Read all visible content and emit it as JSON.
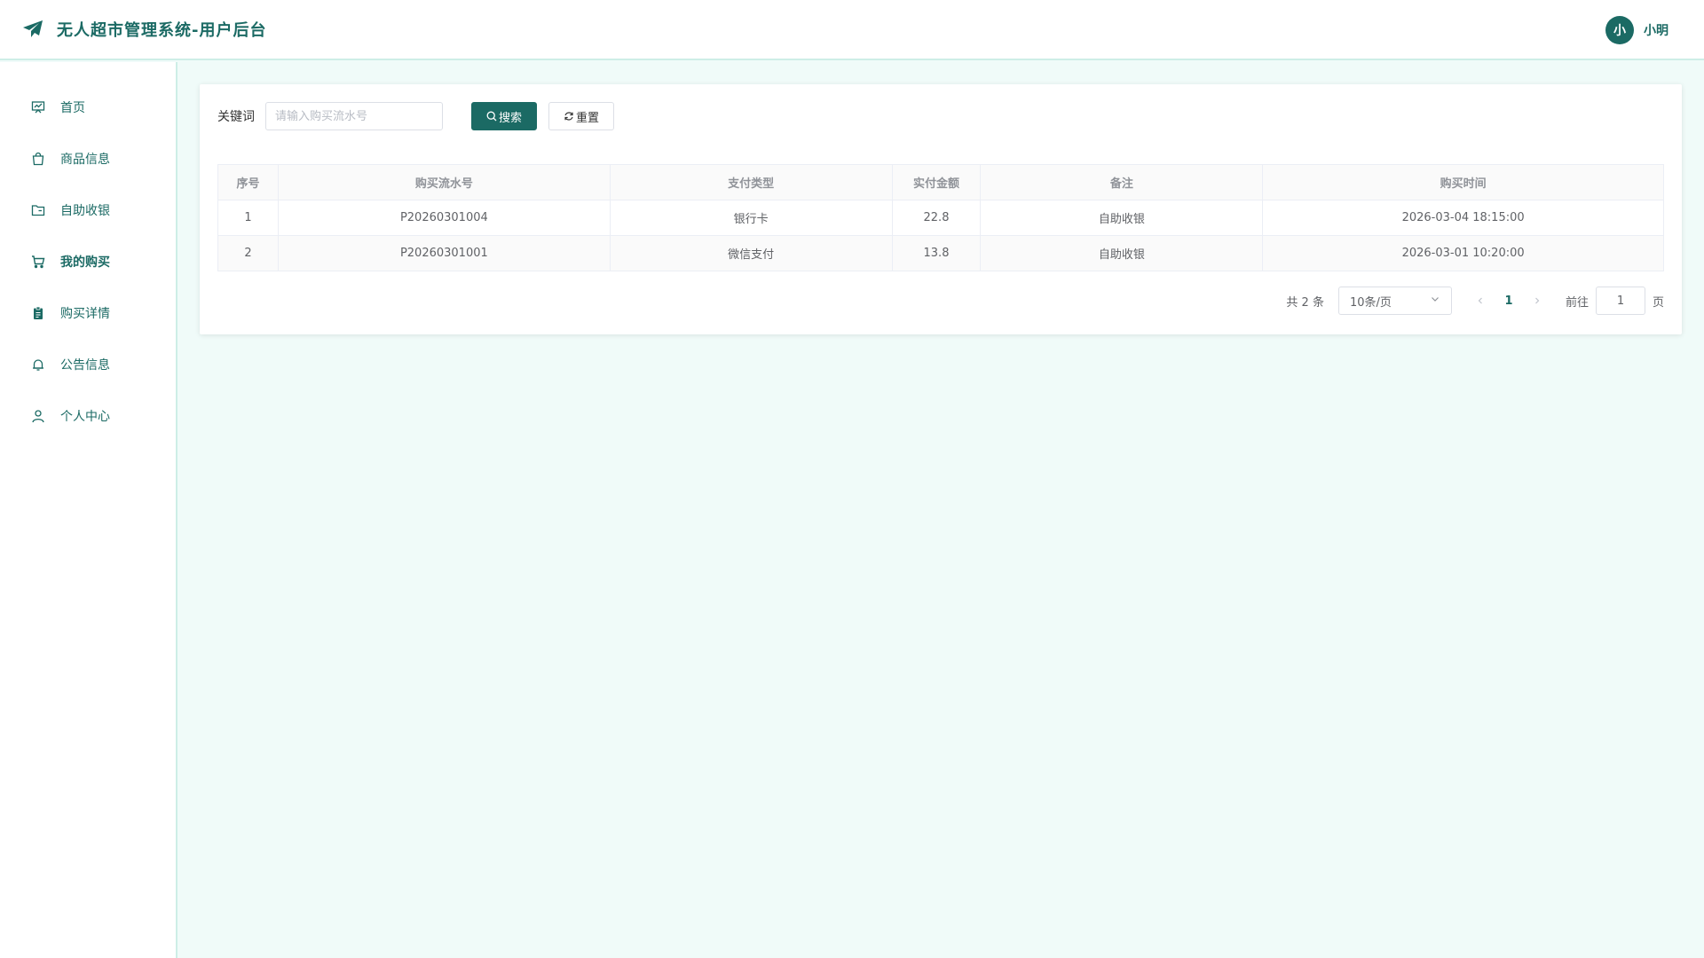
{
  "header": {
    "title": "无人超市管理系统-用户后台",
    "avatar_text": "小",
    "username": "小明"
  },
  "sidebar": {
    "items": [
      {
        "label": "首页",
        "icon": "chart-board-icon"
      },
      {
        "label": "商品信息",
        "icon": "shopping-bag-icon"
      },
      {
        "label": "自助收银",
        "icon": "folder-icon"
      },
      {
        "label": "我的购买",
        "icon": "shopping-cart-icon",
        "active": true
      },
      {
        "label": "购买详情",
        "icon": "clipboard-icon"
      },
      {
        "label": "公告信息",
        "icon": "bell-icon"
      },
      {
        "label": "个人中心",
        "icon": "user-icon"
      }
    ]
  },
  "search": {
    "label": "关键词",
    "placeholder": "请输入购买流水号",
    "value": "",
    "search_label": "搜索",
    "reset_label": "重置"
  },
  "table": {
    "columns": [
      "序号",
      "购买流水号",
      "支付类型",
      "实付金额",
      "备注",
      "购买时间"
    ],
    "rows": [
      [
        "1",
        "P20260301004",
        "银行卡",
        "22.8",
        "自助收银",
        "2026-03-04 18:15:00"
      ],
      [
        "2",
        "P20260301001",
        "微信支付",
        "13.8",
        "自助收银",
        "2026-03-01 10:20:00"
      ]
    ]
  },
  "pagination": {
    "total_text": "共 2 条",
    "page_size": "10条/页",
    "current_page": "1",
    "goto_label": "前往",
    "goto_value": "1",
    "goto_suffix": "页"
  },
  "colors": {
    "primary": "#1b6a64",
    "background": "#f0fbf9",
    "border_accent": "#cdeee7"
  }
}
